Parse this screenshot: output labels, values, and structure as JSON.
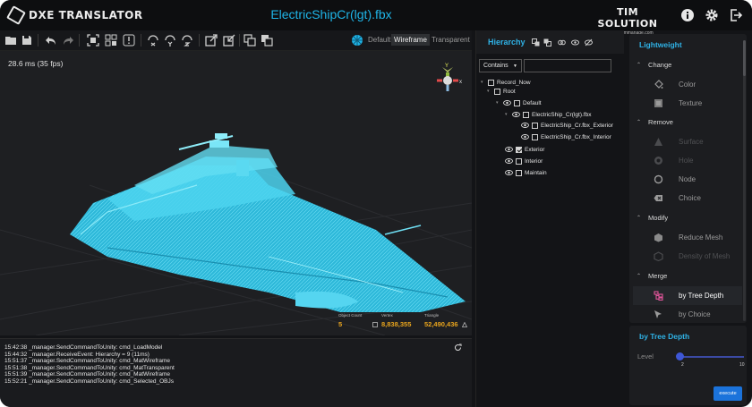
{
  "app": {
    "name": "DXE TRANSLATOR",
    "doc_title": "ElectricShipCr(lgt).fbx",
    "brand_name": "TIM SOLUTION",
    "brand_email": "support@timmanage.com"
  },
  "toolbar": {
    "view_modes": [
      "Default",
      "Wireframe",
      "Transparent"
    ],
    "active_view": "Wireframe"
  },
  "viewport": {
    "fps_text": "28.6 ms (35 fps)",
    "stats": {
      "object_label": "Object Count",
      "object_value": "5",
      "vertex_label": "Vertex",
      "vertex_value": "8,838,355",
      "triangle_label": "Triangle",
      "triangle_value": "52,490,436"
    },
    "model_color": "#35c3e6"
  },
  "console": {
    "lines": [
      "15:42:38 _manager.SendCommandToUnity: cmd_LoadModel",
      "15:44:32 _manager.ReceiveEvent: Hierarchy = 9 (11ms)",
      "15:51:37 _manager.SendCommandToUnity: cmd_MatWireframe",
      "15:51:38 _manager.SendCommandToUnity: cmd_MatTransparent",
      "15:51:39 _manager.SendCommandToUnity: cmd_MatWireframe",
      "15:52:21 _manager.SendCommandToUnity: cmd_Selected_OBJs"
    ]
  },
  "hierarchy": {
    "title": "Hierarchy",
    "filter": "Contains",
    "search_value": "",
    "tree": [
      {
        "label": "Record_Now",
        "checked": false,
        "eye": false
      },
      {
        "label": "Root",
        "checked": false,
        "eye": false
      },
      {
        "label": "Default",
        "checked": false,
        "eye": true
      },
      {
        "label": "ElectricShip_Cr(lgt).fbx",
        "checked": false,
        "eye": true
      },
      {
        "label": "ElectricShip_Cr.fbx_Exterior",
        "checked": false,
        "eye": true
      },
      {
        "label": "ElectricShip_Cr.fbx_Interior",
        "checked": false,
        "eye": true
      },
      {
        "label": "Exterior",
        "checked": true,
        "eye": true
      },
      {
        "label": "Interior",
        "checked": false,
        "eye": true
      },
      {
        "label": "Maintain",
        "checked": false,
        "eye": true
      }
    ]
  },
  "lightweight": {
    "title": "Lightweight",
    "sections": {
      "change": "Change",
      "remove": "Remove",
      "modify": "Modify",
      "merge": "Merge"
    },
    "items": {
      "color": "Color",
      "texture": "Texture",
      "surface": "Surface",
      "hole": "Hole",
      "node": "Node",
      "choice": "Choice",
      "reduce_mesh": "Reduce Mesh",
      "density_of_mesh": "Density of Mesh",
      "by_tree_depth": "by Tree Depth",
      "by_choice": "by Choice"
    },
    "active_item": "by Tree Depth",
    "accent": "#2fb2e6",
    "merge_icon_color": "#e0559a"
  },
  "tree_depth": {
    "title": "by Tree Depth",
    "level_label": "Level",
    "min": "2",
    "max": "10",
    "value": 2,
    "execute_label": "execute"
  }
}
